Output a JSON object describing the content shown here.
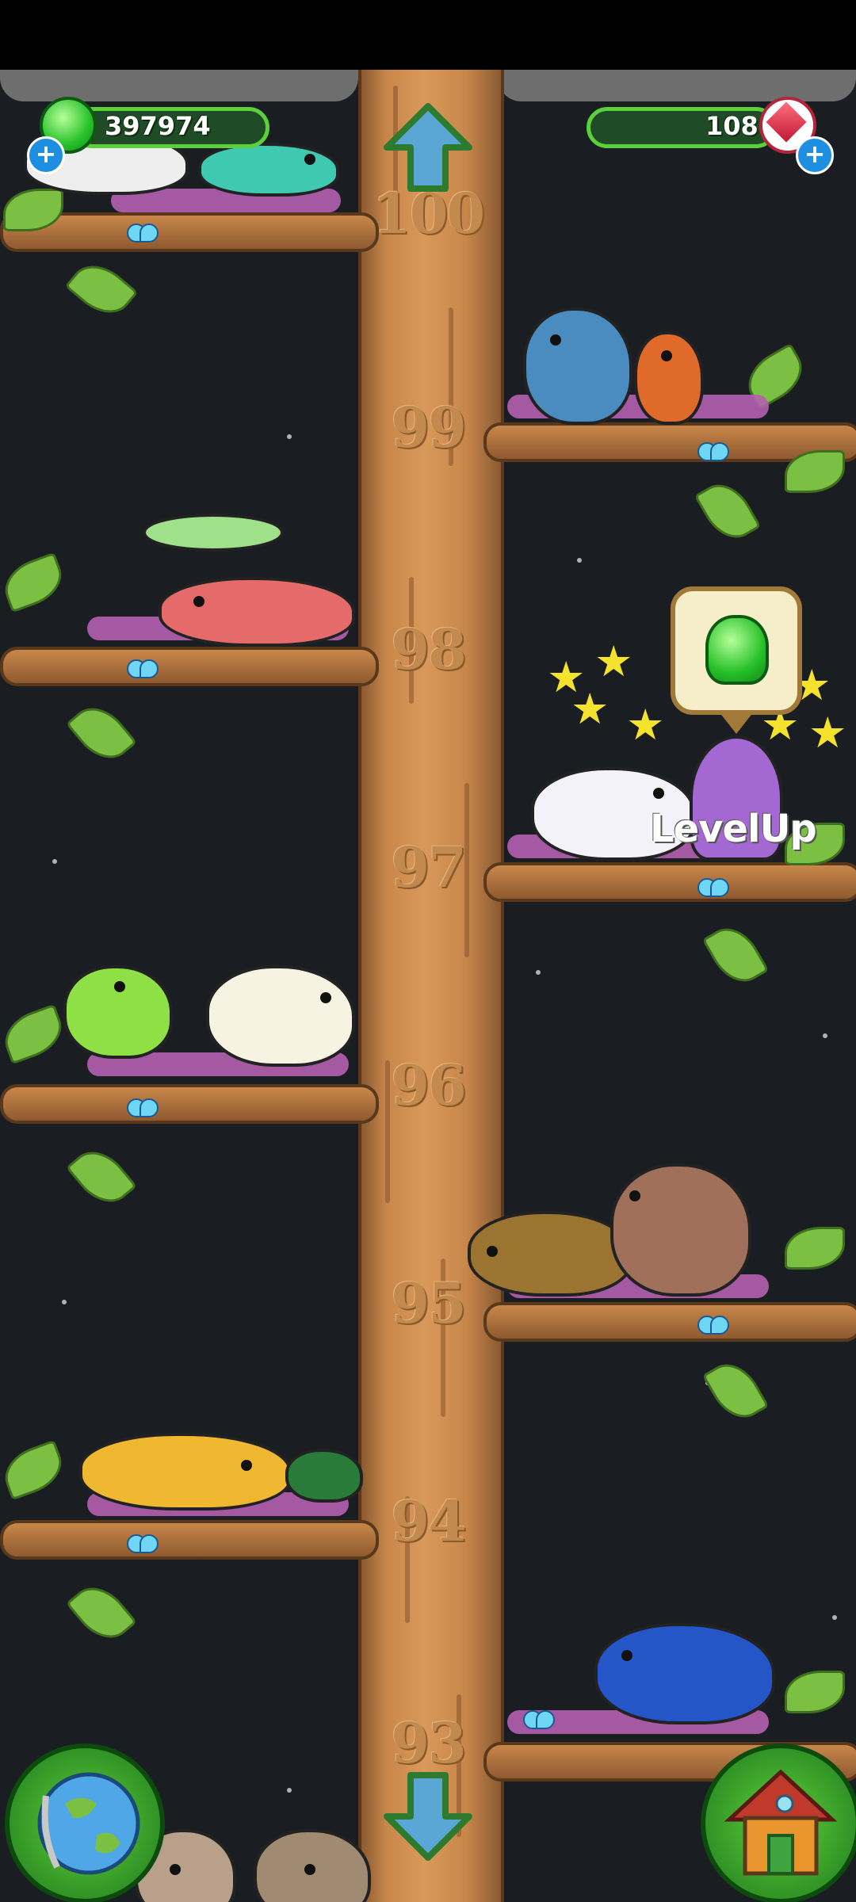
{
  "hud": {
    "gems": "397974",
    "crystals": "108",
    "gem_icon": "green-jelly-gem-icon",
    "crystal_icon": "red-crystal-icon",
    "add_icon": "plus-icon"
  },
  "floors": [
    "100",
    "99",
    "98",
    "97",
    "96",
    "95",
    "94",
    "93"
  ],
  "notification": {
    "text": "LevelUp",
    "reward_icon": "green-jelly-gem-icon"
  },
  "controls": {
    "up_icon": "arrow-up-icon",
    "down_icon": "arrow-down-icon",
    "globe_icon": "globe-icon",
    "house_icon": "house-icon"
  },
  "colors": {
    "background": "#1a1e23",
    "trunk": "#c8874a",
    "leaf": "#7cc043",
    "hud_green": "#5bd03a",
    "floor_label": "#c28a4e"
  }
}
